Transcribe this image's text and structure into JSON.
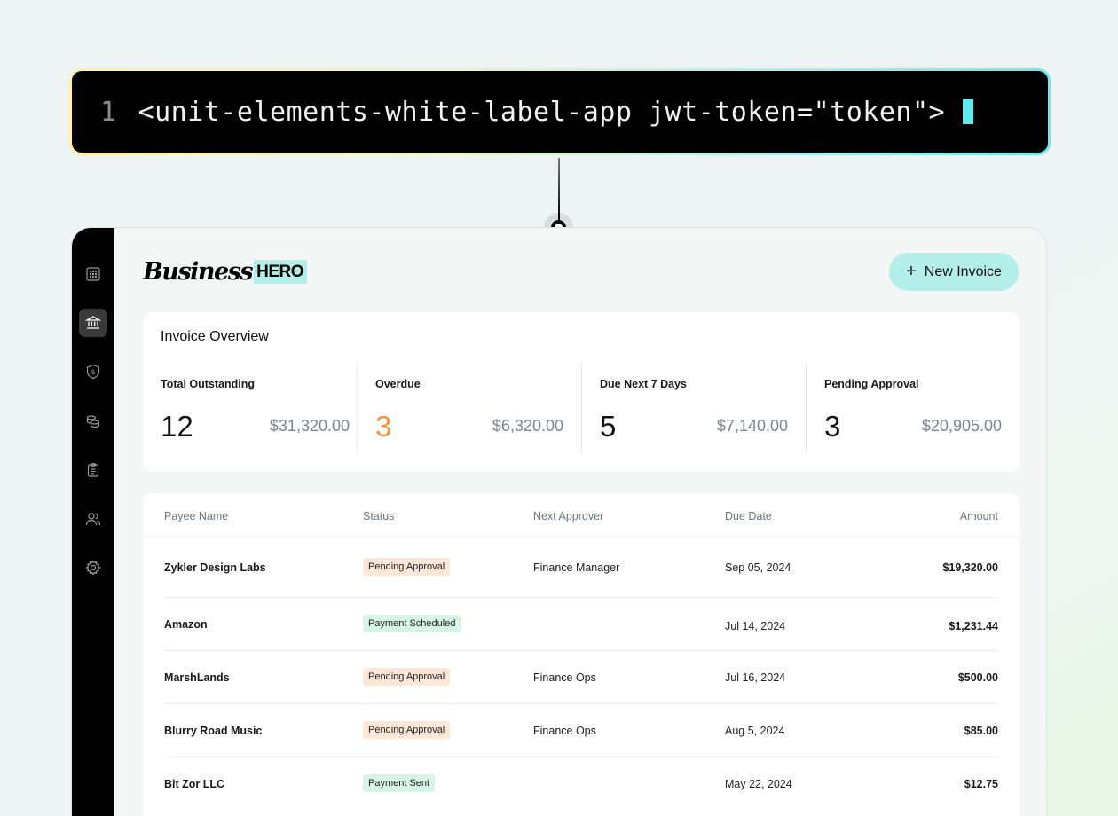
{
  "code": {
    "line_number": "1",
    "snippet": "<unit-elements-white-label-app jwt-token=\"token\">"
  },
  "sidebar": {
    "items": [
      {
        "icon": "calendar-grid-icon",
        "active": false
      },
      {
        "icon": "bank-icon",
        "active": true
      },
      {
        "icon": "dollar-shield-icon",
        "active": false
      },
      {
        "icon": "coins-icon",
        "active": false
      },
      {
        "icon": "clipboard-icon",
        "active": false
      },
      {
        "icon": "users-icon",
        "active": false
      },
      {
        "icon": "gear-icon",
        "active": false
      }
    ]
  },
  "brand": {
    "script": "Business",
    "badge": "HERO"
  },
  "header": {
    "new_invoice_label": "New Invoice"
  },
  "overview": {
    "title": "Invoice Overview",
    "stats": [
      {
        "label": "Total Outstanding",
        "count": "12",
        "amount": "$31,320.00"
      },
      {
        "label": "Overdue",
        "count": "3",
        "amount": "$6,320.00"
      },
      {
        "label": "Due Next 7 Days",
        "count": "5",
        "amount": "$7,140.00"
      },
      {
        "label": "Pending Approval",
        "count": "3",
        "amount": "$20,905.00"
      }
    ]
  },
  "table": {
    "columns": [
      "Payee Name",
      "Status",
      "Next Approver",
      "Due Date",
      "Amount"
    ],
    "rows": [
      {
        "payee": "Zykler Design Labs",
        "status": "Pending Approval",
        "approver": "Finance Manager",
        "due": "Sep 05, 2024",
        "amount": "$19,320.00"
      },
      {
        "payee": "Amazon",
        "status": "Payment Scheduled",
        "approver": "",
        "due": "Jul 14, 2024",
        "amount": "$1,231.44"
      },
      {
        "payee": "MarshLands",
        "status": "Pending Approval",
        "approver": "Finance Ops",
        "due": "Jul 16, 2024",
        "amount": "$500.00"
      },
      {
        "payee": "Blurry Road Music",
        "status": "Pending Approval",
        "approver": "Finance Ops",
        "due": "Aug 5, 2024",
        "amount": "$85.00"
      },
      {
        "payee": "Bit Zor LLC",
        "status": "Payment Sent",
        "approver": "",
        "due": "May 22, 2024",
        "amount": "$12.75"
      }
    ]
  },
  "colors": {
    "accent": "#b3efe8",
    "overdue": "#f2923a",
    "pending_badge": "#fde7d6",
    "scheduled_badge": "#d7f5e6",
    "cursor": "#5ee9ef"
  }
}
